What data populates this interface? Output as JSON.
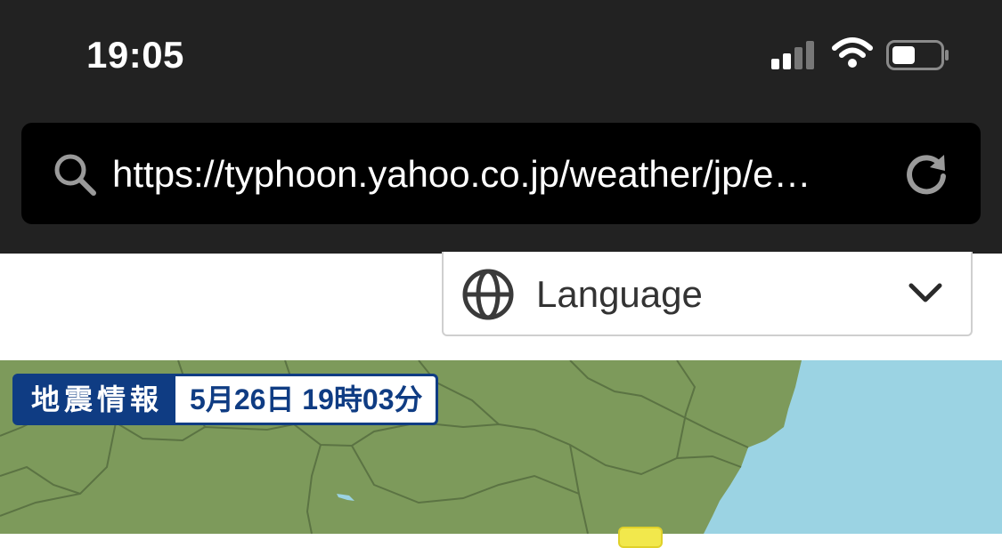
{
  "status_bar": {
    "time": "19:05"
  },
  "url_bar": {
    "url": "https://typhoon.yahoo.co.jp/weather/jp/e…"
  },
  "language_selector": {
    "label": "Language"
  },
  "map": {
    "earthquake_badge": {
      "title": "地震情報",
      "time": "5月26日 19時03分"
    }
  },
  "colors": {
    "chrome": "#222222",
    "land": "#7d9a5b",
    "sea": "#9bd3e3",
    "badge": "#0f3c83"
  }
}
